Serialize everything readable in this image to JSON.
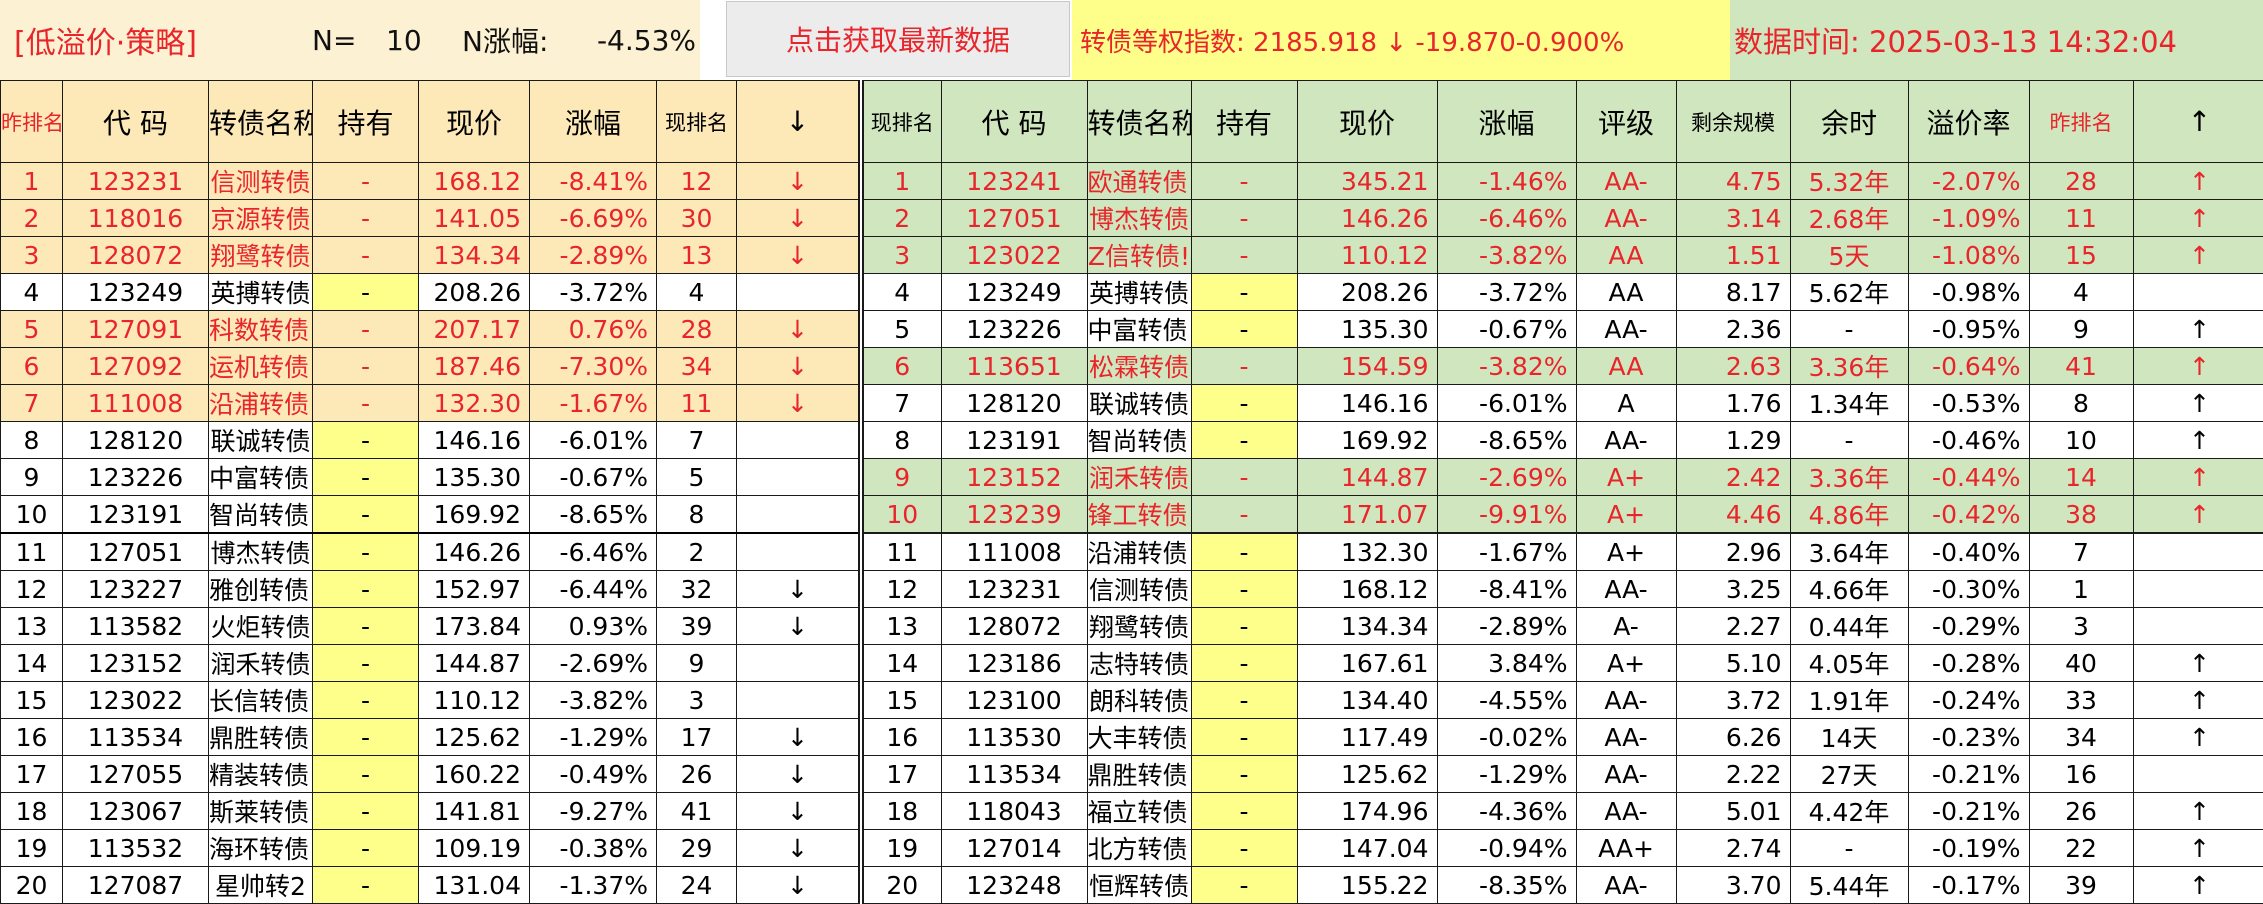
{
  "topbar": {
    "strategy": "[低溢价·策略]",
    "n_label": "N=",
    "n_value": "10",
    "n_change_label": "N涨幅:",
    "n_change_value": "-4.53%",
    "fetch_button": "点击获取最新数据",
    "index_text": "转债等权指数:  2185.918 ↓ -19.870-0.900%",
    "time_text": "数据时间: 2025-03-13 14:32:04"
  },
  "colors": {
    "red": "#e8252a",
    "orange_bg": "#fde9b8",
    "green_bg": "#d0e6bf",
    "yellow_bg": "#fefe8a"
  },
  "left_table": {
    "headers": [
      "昨排名",
      "代 码",
      "转债名称",
      "持有",
      "现价",
      "涨幅",
      "现排名",
      "↓"
    ],
    "rows": [
      [
        "1",
        "123231",
        "信测转债",
        "-",
        "168.12",
        "-8.41%",
        "12",
        "↓"
      ],
      [
        "2",
        "118016",
        "京源转债",
        "-",
        "141.05",
        "-6.69%",
        "30",
        "↓"
      ],
      [
        "3",
        "128072",
        "翔鹭转债",
        "-",
        "134.34",
        "-2.89%",
        "13",
        "↓"
      ],
      [
        "4",
        "123249",
        "英搏转债",
        "-",
        "208.26",
        "-3.72%",
        "4",
        ""
      ],
      [
        "5",
        "127091",
        "科数转债!",
        "-",
        "207.17",
        "0.76%",
        "28",
        "↓"
      ],
      [
        "6",
        "127092",
        "运机转债!",
        "-",
        "187.46",
        "-7.30%",
        "34",
        "↓"
      ],
      [
        "7",
        "111008",
        "沿浦转债!",
        "-",
        "132.30",
        "-1.67%",
        "11",
        "↓"
      ],
      [
        "8",
        "128120",
        "联诚转债",
        "-",
        "146.16",
        "-6.01%",
        "7",
        ""
      ],
      [
        "9",
        "123226",
        "中富转债!",
        "-",
        "135.30",
        "-0.67%",
        "5",
        ""
      ],
      [
        "10",
        "123191",
        "智尚转债!",
        "-",
        "169.92",
        "-8.65%",
        "8",
        ""
      ],
      [
        "11",
        "127051",
        "博杰转债",
        "-",
        "146.26",
        "-6.46%",
        "2",
        ""
      ],
      [
        "12",
        "123227",
        "雅创转债!",
        "-",
        "152.97",
        "-6.44%",
        "32",
        "↓"
      ],
      [
        "13",
        "113582",
        "火炬转债",
        "-",
        "173.84",
        "0.93%",
        "39",
        "↓"
      ],
      [
        "14",
        "123152",
        "润禾转债",
        "-",
        "144.87",
        "-2.69%",
        "9",
        ""
      ],
      [
        "15",
        "123022",
        "长信转债!",
        "-",
        "110.12",
        "-3.82%",
        "3",
        ""
      ],
      [
        "16",
        "113534",
        "鼎胜转债!",
        "-",
        "125.62",
        "-1.29%",
        "17",
        "↓"
      ],
      [
        "17",
        "127055",
        "精装转债!",
        "-",
        "160.22",
        "-0.49%",
        "26",
        "↓"
      ],
      [
        "18",
        "123067",
        "斯莱转债!",
        "-",
        "141.81",
        "-9.27%",
        "41",
        "↓"
      ],
      [
        "19",
        "113532",
        "海环转债!",
        "-",
        "109.19",
        "-0.38%",
        "29",
        "↓"
      ],
      [
        "20",
        "127087",
        "星帅转2",
        "-",
        "131.04",
        "-1.37%",
        "24",
        "↓"
      ]
    ]
  },
  "right_table": {
    "headers": [
      "现排名",
      "代 码",
      "转债名称",
      "持有",
      "现价",
      "涨幅",
      "评级",
      "剩余规模",
      "余时",
      "溢价率",
      "昨排名",
      "↑"
    ],
    "rows": [
      [
        "1",
        "123241",
        "欧通转债!",
        "-",
        "345.21",
        "-1.46%",
        "AA-",
        "4.75",
        "5.32年",
        "-2.07%",
        "28",
        "↑"
      ],
      [
        "2",
        "127051",
        "博杰转债",
        "-",
        "146.26",
        "-6.46%",
        "AA-",
        "3.14",
        "2.68年",
        "-1.09%",
        "11",
        "↑"
      ],
      [
        "3",
        "123022",
        "Z信转债!",
        "-",
        "110.12",
        "-3.82%",
        "AA",
        "1.51",
        "5天",
        "-1.08%",
        "15",
        "↑"
      ],
      [
        "4",
        "123249",
        "英搏转债",
        "-",
        "208.26",
        "-3.72%",
        "AA",
        "8.17",
        "5.62年",
        "-0.98%",
        "4",
        ""
      ],
      [
        "5",
        "123226",
        "中富转债!",
        "-",
        "135.30",
        "-0.67%",
        "AA-",
        "2.36",
        "-",
        "-0.95%",
        "9",
        "↑"
      ],
      [
        "6",
        "113651",
        "松霖转债",
        "-",
        "154.59",
        "-3.82%",
        "AA",
        "2.63",
        "3.36年",
        "-0.64%",
        "41",
        "↑"
      ],
      [
        "7",
        "128120",
        "联诚转债",
        "-",
        "146.16",
        "-6.01%",
        "A",
        "1.76",
        "1.34年",
        "-0.53%",
        "8",
        "↑"
      ],
      [
        "8",
        "123191",
        "智尚转债!",
        "-",
        "169.92",
        "-8.65%",
        "AA-",
        "1.29",
        "-",
        "-0.46%",
        "10",
        "↑"
      ],
      [
        "9",
        "123152",
        "润禾转债",
        "-",
        "144.87",
        "-2.69%",
        "A+",
        "2.42",
        "3.36年",
        "-0.44%",
        "14",
        "↑"
      ],
      [
        "10",
        "123239",
        "锋工转债!",
        "-",
        "171.07",
        "-9.91%",
        "A+",
        "4.46",
        "4.86年",
        "-0.42%",
        "38",
        "↑"
      ],
      [
        "11",
        "111008",
        "沿浦转债!",
        "-",
        "132.30",
        "-1.67%",
        "A+",
        "2.96",
        "3.64年",
        "-0.40%",
        "7",
        ""
      ],
      [
        "12",
        "123231",
        "信测转债",
        "-",
        "168.12",
        "-8.41%",
        "AA-",
        "3.25",
        "4.66年",
        "-0.30%",
        "1",
        ""
      ],
      [
        "13",
        "128072",
        "翔鹭转债",
        "-",
        "134.34",
        "-2.89%",
        "A-",
        "2.27",
        "0.44年",
        "-0.29%",
        "3",
        ""
      ],
      [
        "14",
        "123186",
        "志特转债",
        "-",
        "167.61",
        "3.84%",
        "A+",
        "5.10",
        "4.05年",
        "-0.28%",
        "40",
        "↑"
      ],
      [
        "15",
        "123100",
        "朗科转债",
        "-",
        "134.40",
        "-4.55%",
        "AA-",
        "3.72",
        "1.91年",
        "-0.24%",
        "33",
        "↑"
      ],
      [
        "16",
        "113530",
        "大丰转债!",
        "-",
        "117.49",
        "-0.02%",
        "AA-",
        "6.26",
        "14天",
        "-0.23%",
        "34",
        "↑"
      ],
      [
        "17",
        "113534",
        "鼎胜转债!",
        "-",
        "125.62",
        "-1.29%",
        "AA-",
        "2.22",
        "27天",
        "-0.21%",
        "16",
        ""
      ],
      [
        "18",
        "118043",
        "福立转债!",
        "-",
        "174.96",
        "-4.36%",
        "AA-",
        "5.01",
        "4.42年",
        "-0.21%",
        "26",
        "↑"
      ],
      [
        "19",
        "127014",
        "北方转债!",
        "-",
        "147.04",
        "-0.94%",
        "AA+",
        "2.74",
        "-",
        "-0.19%",
        "22",
        "↑"
      ],
      [
        "20",
        "123248",
        "恒辉转债",
        "-",
        "155.22",
        "-8.35%",
        "AA-",
        "3.70",
        "5.44年",
        "-0.17%",
        "39",
        "↑"
      ]
    ]
  }
}
